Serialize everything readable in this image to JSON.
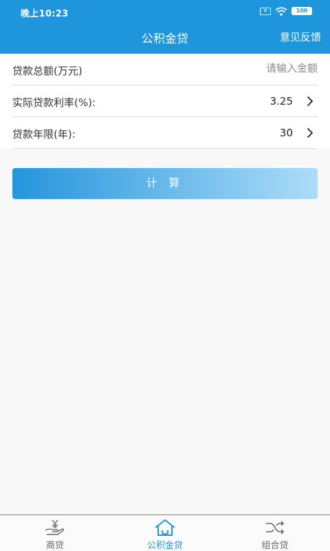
{
  "status": {
    "time": "晚上10:23",
    "sim": "✕",
    "battery": "100"
  },
  "header": {
    "title": "公积金贷",
    "feedback": "意见反馈"
  },
  "form": {
    "loan_amount": {
      "label": "贷款总额(万元)",
      "placeholder": "请输入金额",
      "value": ""
    },
    "rate": {
      "label": "实际贷款利率(%):",
      "value": "3.25"
    },
    "years": {
      "label": "贷款年限(年):",
      "value": "30"
    }
  },
  "calc_button": "计 算",
  "tabs": [
    {
      "label": "商贷",
      "icon": "yuan-hand-icon",
      "active": false
    },
    {
      "label": "公积金贷",
      "icon": "house-icon",
      "active": true
    },
    {
      "label": "组合贷",
      "icon": "shuffle-icon",
      "active": false
    }
  ],
  "colors": {
    "accent": "#1f95dc",
    "background": "#f8f8f8",
    "tab_inactive": "#666666"
  }
}
